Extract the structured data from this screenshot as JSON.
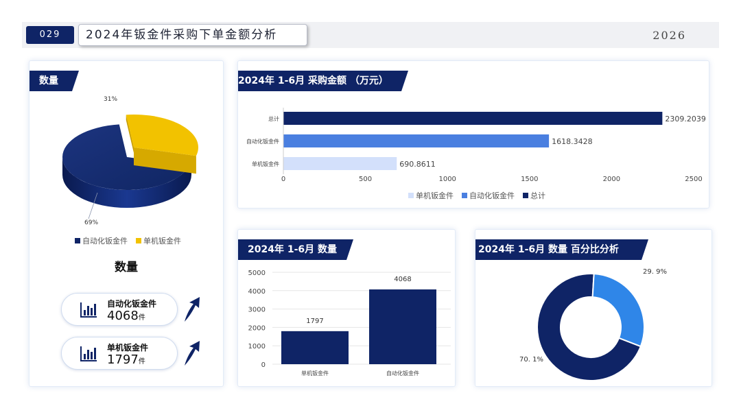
{
  "header": {
    "page_number": "029",
    "title": "2024年钣金件采购下单金额分析",
    "year": "2026"
  },
  "left_card": {
    "tag": "数量",
    "pie_labels": {
      "auto": "69%",
      "single": "31%"
    },
    "legend": [
      "自动化钣金件",
      "单机钣金件"
    ],
    "subtitle": "数量",
    "stats": [
      {
        "label": "自动化钣金件",
        "value": "4068",
        "unit": "件"
      },
      {
        "label": "单机钣金件",
        "value": "1797",
        "unit": "件"
      }
    ]
  },
  "bar_card": {
    "tag": "2024年 1-6月 采购金额 （万元）",
    "legend": [
      "单机钣金件",
      "自动化钣金件",
      "总计"
    ]
  },
  "column_card": {
    "tag": "2024年 1-6月 数量"
  },
  "donut_card": {
    "tag": "2024年 1-6月 数量 百分比分析"
  },
  "colors": {
    "navy": "#0f2466",
    "mid_blue": "#4a7fe0",
    "light_blue": "#d3e0fb",
    "yellow": "#f2c200",
    "donut_blue": "#2f86e8"
  },
  "chart_data": [
    {
      "type": "pie",
      "categories": [
        "自动化钣金件",
        "单机钣金件"
      ],
      "values": [
        69,
        31
      ],
      "labels": [
        "69%",
        "31%"
      ]
    },
    {
      "type": "bar",
      "orientation": "horizontal",
      "categories": [
        "总计",
        "自动化钣金件",
        "单机钣金件"
      ],
      "values": [
        2309.2039,
        1618.3428,
        690.8611
      ],
      "value_labels": [
        "2309.2039",
        "1618.3428",
        "690.8611"
      ],
      "xlim": [
        0,
        2500
      ],
      "xticks": [
        "0",
        "500",
        "1000",
        "1500",
        "2000",
        "2500"
      ],
      "legend": [
        "单机钣金件",
        "自动化钣金件",
        "总计"
      ],
      "legend_position": "bottom"
    },
    {
      "type": "bar",
      "categories": [
        "单机钣金件",
        "自动化钣金件"
      ],
      "values": [
        1797,
        4068
      ],
      "value_labels": [
        "1797",
        "4068"
      ],
      "ylim": [
        0,
        5000
      ],
      "yticks": [
        "0",
        "1000",
        "2000",
        "3000",
        "4000",
        "5000"
      ],
      "grid": true
    },
    {
      "type": "pie",
      "style": "donut",
      "categories": [
        "自动化钣金件",
        "单机钣金件"
      ],
      "values": [
        70.1,
        29.9
      ],
      "labels": [
        "70. 1%",
        "29. 9%"
      ]
    }
  ]
}
